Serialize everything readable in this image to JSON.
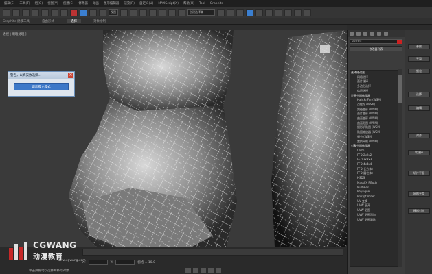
{
  "menubar": [
    "编辑(E)",
    "工具(T)",
    "组(G)",
    "视图(V)",
    "创建(C)",
    "修改器",
    "动画",
    "图形编辑器",
    "渲染(R)",
    "自定义(U)",
    "MAXScript(X)",
    "帮助(H)",
    "Tool",
    "Graphite"
  ],
  "toolbar": {
    "view_dropdown": "视图",
    "selection_set": "创建选择集"
  },
  "ribbon": {
    "tabs": [
      "Graphite 建模工具",
      "自由形式",
      "选择",
      "对象绘制"
    ],
    "active_index": 2
  },
  "viewport": {
    "label": "透视 | 明暗处理 ]"
  },
  "dialog": {
    "title": "警告，以真实数选择...",
    "button": "退出孤立模式"
  },
  "panel1": {
    "object_name": "Box001",
    "list_title": "修改器列表",
    "modifiers": [
      {
        "text": "选择修改器",
        "kind": "h"
      },
      {
        "text": "网格选择",
        "kind": "i"
      },
      {
        "text": "面片选择",
        "kind": "i"
      },
      {
        "text": "多边形选择",
        "kind": "i"
      },
      {
        "text": "体积选择",
        "kind": "i"
      },
      {
        "text": "世界空间修改器",
        "kind": "h"
      },
      {
        "text": "Hair 和 Fur (WSM)",
        "kind": "i"
      },
      {
        "text": "点缓存 (WSM)",
        "kind": "i"
      },
      {
        "text": "路径变形 (WSM)",
        "kind": "i"
      },
      {
        "text": "面片变形 (WSM)",
        "kind": "i"
      },
      {
        "text": "曲面变形 (WSM)",
        "kind": "i"
      },
      {
        "text": "曲面贴图 (WSM)",
        "kind": "i"
      },
      {
        "text": "摄影机贴图 (WSM)",
        "kind": "i"
      },
      {
        "text": "贴图缩放器 (WSM)",
        "kind": "i"
      },
      {
        "text": "细分 (WSM)",
        "kind": "i"
      },
      {
        "text": "置换网格 (WSM)",
        "kind": "i"
      },
      {
        "text": "对象空间修改器",
        "kind": "h"
      },
      {
        "text": "Cloth",
        "kind": "i"
      },
      {
        "text": "FFD 2x2x2",
        "kind": "i"
      },
      {
        "text": "FFD 3x3x3",
        "kind": "i"
      },
      {
        "text": "FFD 4x4x4",
        "kind": "i"
      },
      {
        "text": "FFD(长方体)",
        "kind": "i"
      },
      {
        "text": "FFD(圆柱体)",
        "kind": "i"
      },
      {
        "text": "HSDS",
        "kind": "i"
      },
      {
        "text": "MassFX RBody",
        "kind": "i"
      },
      {
        "text": "MultiRes",
        "kind": "i"
      },
      {
        "text": "Physique",
        "kind": "i"
      },
      {
        "text": "ProOptimizer",
        "kind": "i"
      },
      {
        "text": "UV 变换",
        "kind": "i"
      },
      {
        "text": "UVW 展开",
        "kind": "i"
      },
      {
        "text": "UVW 贴图",
        "kind": "i"
      },
      {
        "text": "UVW 贴图添加",
        "kind": "i"
      },
      {
        "text": "UVW 贴图清除",
        "kind": "i"
      }
    ]
  },
  "panel2": {
    "buttons": [
      "参数",
      "平滑",
      "细化",
      "选择",
      "编辑",
      "对齐",
      "软选择",
      "切片平面",
      "网格平滑",
      "栅格对齐"
    ]
  },
  "status": {
    "x_label": "X:",
    "y_label": "Y:",
    "x_value": "",
    "y_value": "",
    "grid": "栅格 = 10.0"
  },
  "logo": {
    "en": "CGWANG",
    "cn": "动漫教育",
    "url": "www.cgwang.com"
  },
  "bottom_text": "单击并拖动以选择并移动对象"
}
